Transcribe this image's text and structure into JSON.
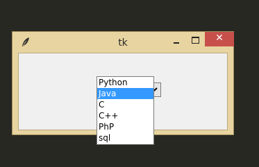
{
  "window": {
    "title": "tk",
    "close_glyph": "✕",
    "icon": "feather-icon"
  },
  "combobox": {
    "value": "",
    "options": [
      "Python",
      "Java",
      "C",
      "C++",
      "PhP",
      "sql"
    ],
    "highlighted": "Java"
  },
  "colors": {
    "desktop": "#272822",
    "titlebar": "#e8d4a0",
    "close_button": "#c7504b",
    "highlight": "#3399ff"
  }
}
